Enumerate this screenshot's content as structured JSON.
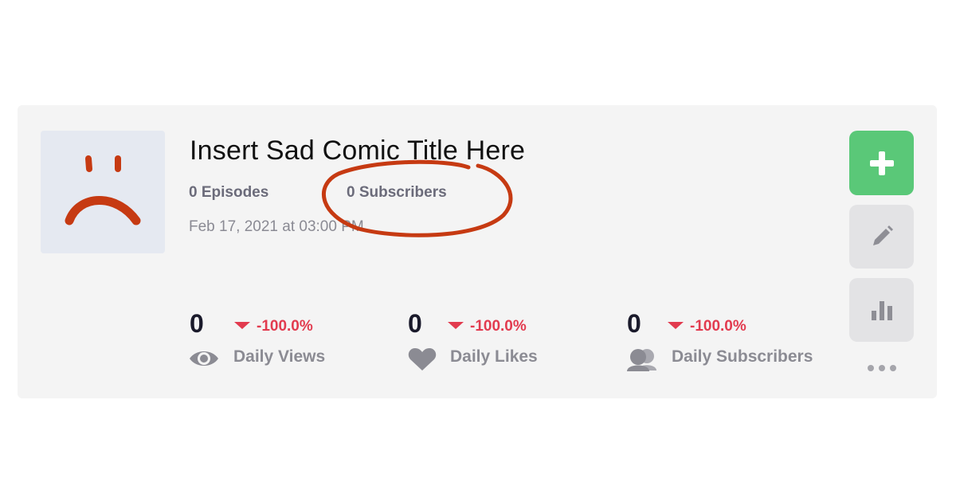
{
  "comic": {
    "title": "Insert Sad Comic Title Here",
    "episodes": "0 Episodes",
    "subscribers": "0 Subscribers",
    "date": "Feb 17, 2021 at 03:00 PM"
  },
  "stats": [
    {
      "value": "0",
      "delta": "-100.0%",
      "label": "Daily Views",
      "icon": "eye-icon"
    },
    {
      "value": "0",
      "delta": "-100.0%",
      "label": "Daily Likes",
      "icon": "heart-icon"
    },
    {
      "value": "0",
      "delta": "-100.0%",
      "label": "Daily Subscribers",
      "icon": "users-icon"
    }
  ],
  "actions": {
    "add_icon": "plus-icon",
    "edit_icon": "pencil-icon",
    "stats_icon": "bar-chart-icon",
    "more_icon": "more-icon"
  },
  "colors": {
    "accent_green": "#5ac878",
    "negative_red": "#e23b4f",
    "annotation_red": "#c63a12"
  }
}
